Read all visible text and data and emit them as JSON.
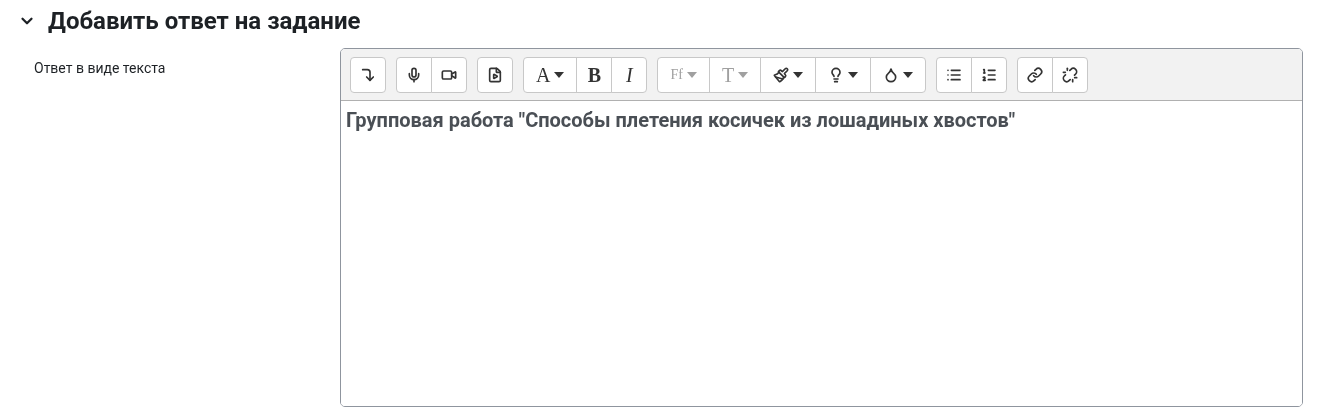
{
  "section": {
    "title": "Добавить ответ на задание",
    "expanded": true
  },
  "field": {
    "label": "Ответ в виде текста"
  },
  "toolbar": [
    [
      {
        "kind": "collapse",
        "dropdown": false,
        "disabled": false
      }
    ],
    [
      {
        "kind": "mic",
        "dropdown": false,
        "disabled": false
      },
      {
        "kind": "video",
        "dropdown": false,
        "disabled": false
      }
    ],
    [
      {
        "kind": "media",
        "dropdown": false,
        "disabled": false
      }
    ],
    [
      {
        "kind": "letter",
        "label": "A",
        "dropdown": true,
        "disabled": false
      },
      {
        "kind": "bold",
        "label": "B",
        "dropdown": false,
        "disabled": false
      },
      {
        "kind": "italic",
        "label": "I",
        "dropdown": false,
        "disabled": false
      }
    ],
    [
      {
        "kind": "font",
        "label": "Ff",
        "dropdown": true,
        "disabled": true
      },
      {
        "kind": "letter",
        "label": "T",
        "dropdown": true,
        "disabled": true
      },
      {
        "kind": "brush",
        "dropdown": true,
        "disabled": false
      },
      {
        "kind": "bulb",
        "dropdown": true,
        "disabled": false
      },
      {
        "kind": "drop",
        "dropdown": true,
        "disabled": false
      }
    ],
    [
      {
        "kind": "ul",
        "dropdown": false,
        "disabled": false
      },
      {
        "kind": "ol",
        "dropdown": false,
        "disabled": false
      }
    ],
    [
      {
        "kind": "link",
        "dropdown": false,
        "disabled": false
      },
      {
        "kind": "unlink",
        "dropdown": false,
        "disabled": false
      }
    ]
  ],
  "content": "Групповая работа \"Способы плетения косичек из лошадиных хвостов\""
}
